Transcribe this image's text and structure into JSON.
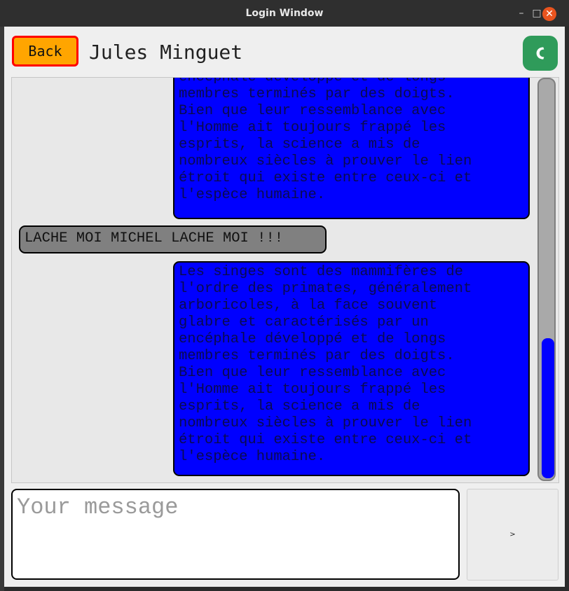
{
  "window": {
    "title": "Login Window"
  },
  "header": {
    "back_label": "Back",
    "contact_name": "Jules Minguet",
    "call_icon": "phone-icon"
  },
  "messages": [
    {
      "side": "sent",
      "text": "encéphale développé et de longs\nmembres terminés par des doigts.\nBien que leur ressemblance avec\nl'Homme ait toujours frappé les\nesprits, la science a mis de\nnombreux siècles à prouver le lien\nétroit qui existe entre ceux-ci et\nl'espèce humaine."
    },
    {
      "side": "recv",
      "text": "LACHE MOI MICHEL LACHE MOI !!!"
    },
    {
      "side": "sent",
      "text": "Les singes sont des mammifères de\nl'ordre des primates, généralement\narboricoles, à la face souvent\nglabre et caractérisés par un\nencéphale développé et de longs\nmembres terminés par des doigts.\nBien que leur ressemblance avec\nl'Homme ait toujours frappé les\nesprits, la science a mis de\nnombreux siècles à prouver le lien\nétroit qui existe entre ceux-ci et\nl'espèce humaine."
    }
  ],
  "scroll": {
    "position": 0.78
  },
  "composer": {
    "placeholder": "Your message",
    "value": "",
    "send_label": ">"
  },
  "colors": {
    "back_bg": "#ffa500",
    "back_border": "#ff0000",
    "sent_bubble": "#0000ff",
    "recv_bubble": "#808080",
    "call_bg": "#2f9b5a"
  }
}
